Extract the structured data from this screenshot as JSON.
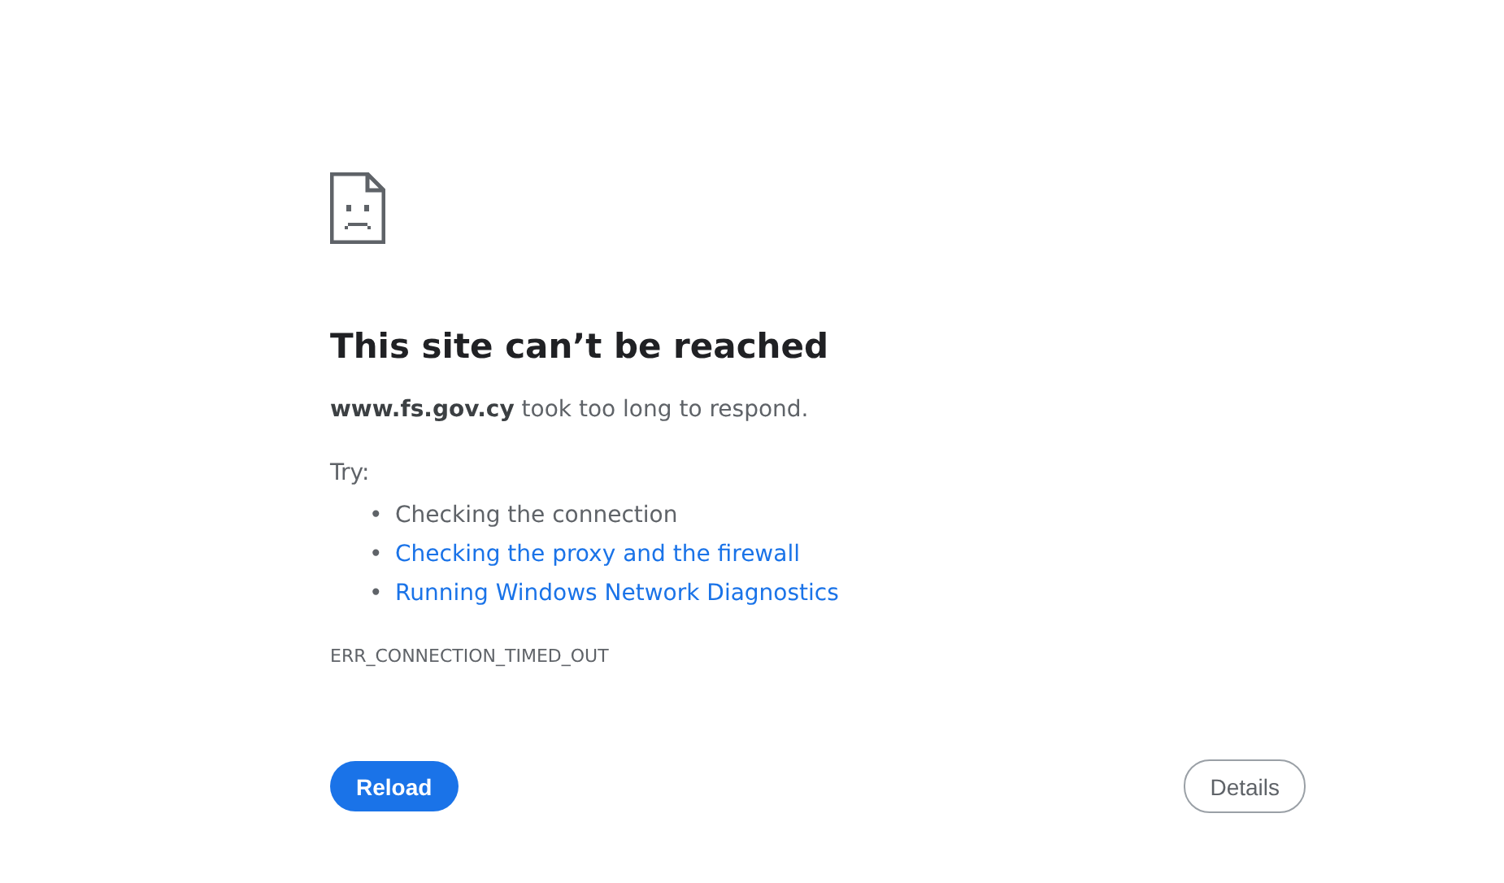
{
  "heading": "This site can’t be reached",
  "message": "**www.fs.gov.cy** took too long to respond.",
  "try_label": "Try:",
  "suggestions": [
    {
      "bullet": "•",
      "text": "Checking the connection",
      "kind": "text"
    },
    {
      "bullet": "•",
      "text": "Checking the proxy and the firewall",
      "kind": "link"
    },
    {
      "bullet": "•",
      "text": "Running Windows Network Diagnostics",
      "kind": "link"
    }
  ],
  "error_code": "ERR_CONNECTION_TIMED_OUT",
  "buttons": [
    {
      "label": "Reload",
      "kind": "primary"
    },
    {
      "label": "Details",
      "kind": "secondary"
    }
  ]
}
